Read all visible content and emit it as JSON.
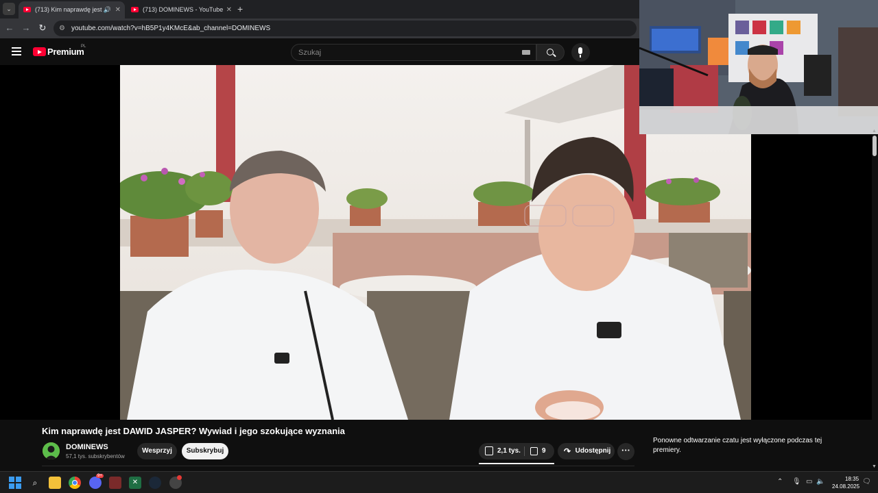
{
  "browser": {
    "tabs": [
      {
        "title": "(713) Kim naprawdę jest DAWID JASPER? Wywiad i jego szokujące wyznania",
        "active": true,
        "audio": true
      },
      {
        "title": "(713) DOMINEWS - YouTube",
        "active": false
      }
    ],
    "new_tab_label": "+",
    "url": "youtube.com/watch?v=hB5P1y4KMcE&ab_channel=DOMINEWS"
  },
  "youtube": {
    "logo_text": "Premium",
    "country_code": "PL",
    "search_placeholder": "Szukaj"
  },
  "video": {
    "title": "Kim naprawdę jest DAWID JASPER? Wywiad i jego szokujące wyznania",
    "channel": "DOMINEWS",
    "subscribers": "57,1 tys. subskrybentów",
    "join_label": "Wesprzyj",
    "subscribe_label": "Subskrybuj",
    "likes": "2,1 tys.",
    "dislikes": "9",
    "share_label": "Udostępnij",
    "more_label": "···"
  },
  "chat": {
    "message": "Ponowne odtwarzanie czatu jest wyłączone podczas tej premiery."
  },
  "taskbar": {
    "time": "18:35",
    "date": "24.08.2025",
    "discord_badge": "9+"
  },
  "colors": {
    "youtube_red": "#ff0033",
    "background": "#0f0f0f",
    "button_dark": "#272727",
    "subscribe_bg": "#f1f1f1"
  }
}
